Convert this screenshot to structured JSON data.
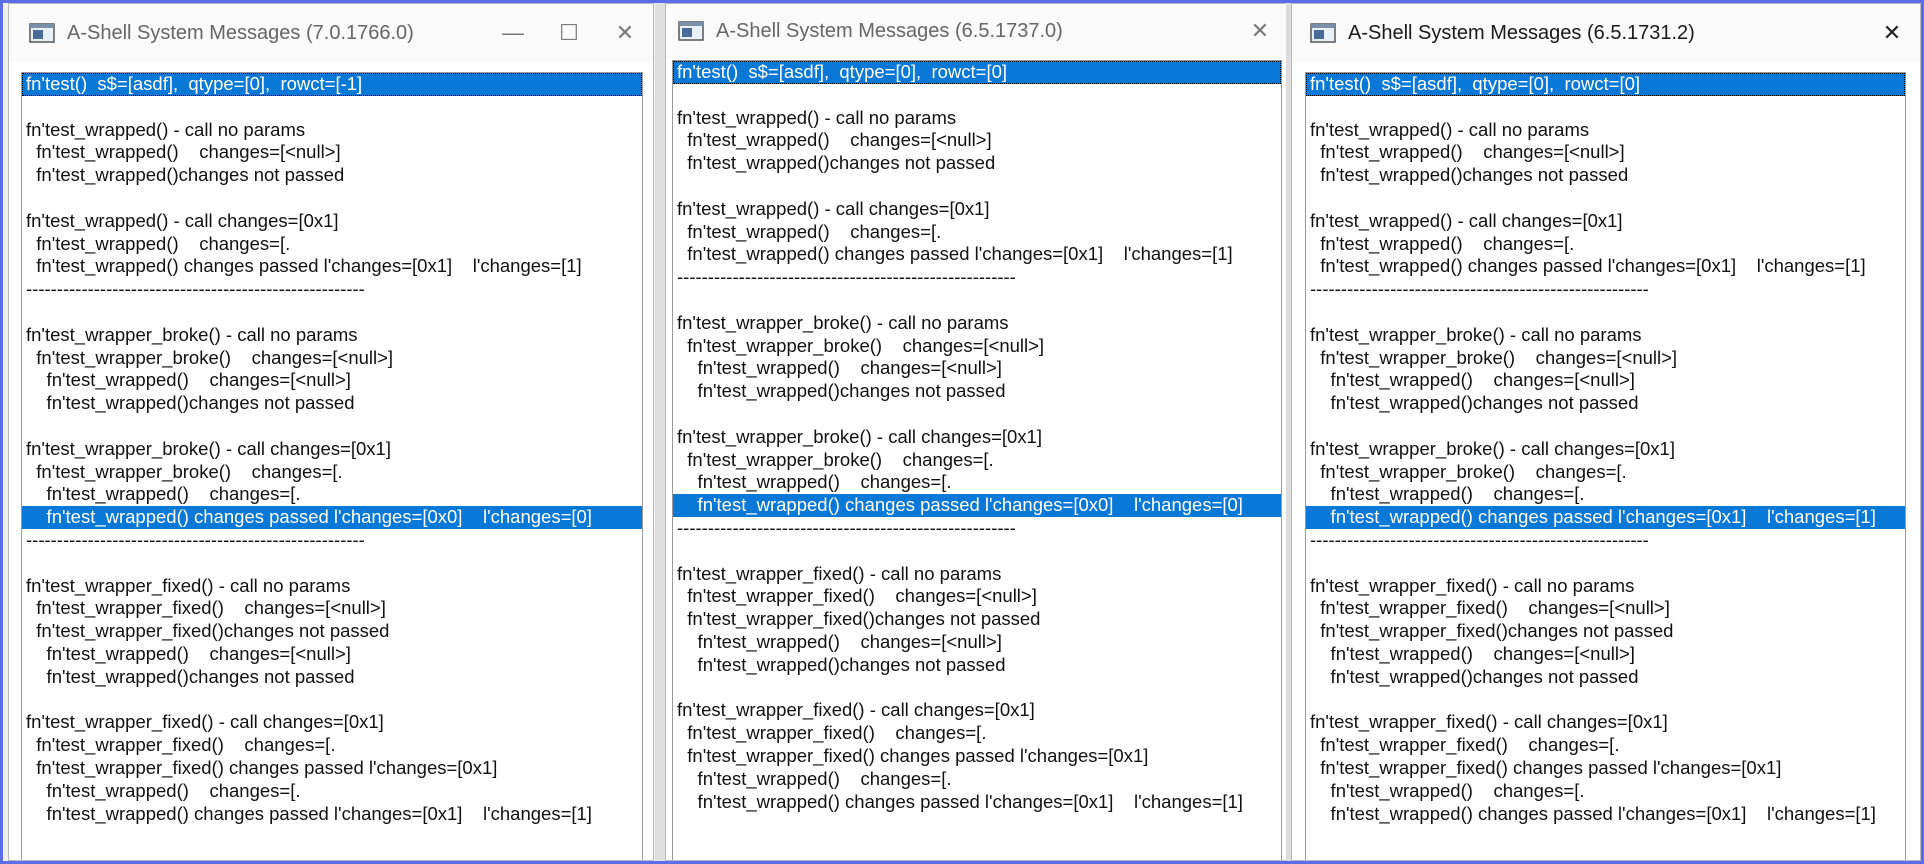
{
  "windows": [
    {
      "title": "A-Shell System Messages (7.0.1766.0)",
      "selected": [
        0,
        19
      ],
      "lines": [
        "fn'test()  s$=[asdf],  qtype=[0],  rowct=[-1]",
        "",
        "fn'test_wrapped() - call no params",
        "  fn'test_wrapped()    changes=[<null>]",
        "  fn'test_wrapped()changes not passed",
        "",
        "fn'test_wrapped() - call changes=[0x1]",
        "  fn'test_wrapped()    changes=[.",
        "  fn'test_wrapped() changes passed l'changes=[0x1]    l'changes=[1]",
        "-------------------------------------------------------",
        "",
        "fn'test_wrapper_broke() - call no params",
        "  fn'test_wrapper_broke()    changes=[<null>]",
        "    fn'test_wrapped()    changes=[<null>]",
        "    fn'test_wrapped()changes not passed",
        "",
        "fn'test_wrapper_broke() - call changes=[0x1]",
        "  fn'test_wrapper_broke()    changes=[.",
        "    fn'test_wrapped()    changes=[.",
        "    fn'test_wrapped() changes passed l'changes=[0x0]    l'changes=[0]",
        "-------------------------------------------------------",
        "",
        "fn'test_wrapper_fixed() - call no params",
        "  fn'test_wrapper_fixed()    changes=[<null>]",
        "  fn'test_wrapper_fixed()changes not passed",
        "    fn'test_wrapped()    changes=[<null>]",
        "    fn'test_wrapped()changes not passed",
        "",
        "fn'test_wrapper_fixed() - call changes=[0x1]",
        "  fn'test_wrapper_fixed()    changes=[.",
        "  fn'test_wrapper_fixed() changes passed l'changes=[0x1]",
        "    fn'test_wrapped()    changes=[.",
        "    fn'test_wrapped() changes passed l'changes=[0x1]    l'changes=[1]"
      ]
    },
    {
      "title": "A-Shell System Messages (6.5.1737.0)",
      "selected": [
        0,
        19
      ],
      "lines": [
        "fn'test()  s$=[asdf],  qtype=[0],  rowct=[0]",
        "",
        "fn'test_wrapped() - call no params",
        "  fn'test_wrapped()    changes=[<null>]",
        "  fn'test_wrapped()changes not passed",
        "",
        "fn'test_wrapped() - call changes=[0x1]",
        "  fn'test_wrapped()    changes=[.",
        "  fn'test_wrapped() changes passed l'changes=[0x1]    l'changes=[1]",
        "-------------------------------------------------------",
        "",
        "fn'test_wrapper_broke() - call no params",
        "  fn'test_wrapper_broke()    changes=[<null>]",
        "    fn'test_wrapped()    changes=[<null>]",
        "    fn'test_wrapped()changes not passed",
        "",
        "fn'test_wrapper_broke() - call changes=[0x1]",
        "  fn'test_wrapper_broke()    changes=[.",
        "    fn'test_wrapped()    changes=[.",
        "    fn'test_wrapped() changes passed l'changes=[0x0]    l'changes=[0]",
        "-------------------------------------------------------",
        "",
        "fn'test_wrapper_fixed() - call no params",
        "  fn'test_wrapper_fixed()    changes=[<null>]",
        "  fn'test_wrapper_fixed()changes not passed",
        "    fn'test_wrapped()    changes=[<null>]",
        "    fn'test_wrapped()changes not passed",
        "",
        "fn'test_wrapper_fixed() - call changes=[0x1]",
        "  fn'test_wrapper_fixed()    changes=[.",
        "  fn'test_wrapper_fixed() changes passed l'changes=[0x1]",
        "    fn'test_wrapped()    changes=[.",
        "    fn'test_wrapped() changes passed l'changes=[0x1]    l'changes=[1]"
      ]
    },
    {
      "title": "A-Shell System Messages (6.5.1731.2)",
      "selected": [
        0,
        19
      ],
      "lines": [
        "fn'test()  s$=[asdf],  qtype=[0],  rowct=[0]",
        "",
        "fn'test_wrapped() - call no params",
        "  fn'test_wrapped()    changes=[<null>]",
        "  fn'test_wrapped()changes not passed",
        "",
        "fn'test_wrapped() - call changes=[0x1]",
        "  fn'test_wrapped()    changes=[.",
        "  fn'test_wrapped() changes passed l'changes=[0x1]    l'changes=[1]",
        "-------------------------------------------------------",
        "",
        "fn'test_wrapper_broke() - call no params",
        "  fn'test_wrapper_broke()    changes=[<null>]",
        "    fn'test_wrapped()    changes=[<null>]",
        "    fn'test_wrapped()changes not passed",
        "",
        "fn'test_wrapper_broke() - call changes=[0x1]",
        "  fn'test_wrapper_broke()    changes=[.",
        "    fn'test_wrapped()    changes=[.",
        "    fn'test_wrapped() changes passed l'changes=[0x1]    l'changes=[1]",
        "-------------------------------------------------------",
        "",
        "fn'test_wrapper_fixed() - call no params",
        "  fn'test_wrapper_fixed()    changes=[<null>]",
        "  fn'test_wrapper_fixed()changes not passed",
        "    fn'test_wrapped()    changes=[<null>]",
        "    fn'test_wrapped()changes not passed",
        "",
        "fn'test_wrapper_fixed() - call changes=[0x1]",
        "  fn'test_wrapper_fixed()    changes=[.",
        "  fn'test_wrapper_fixed() changes passed l'changes=[0x1]",
        "    fn'test_wrapped()    changes=[.",
        "    fn'test_wrapped() changes passed l'changes=[0x1]    l'changes=[1]"
      ]
    }
  ],
  "controls": {
    "minimize": "—",
    "maximize": "☐",
    "close": "✕"
  },
  "colors": {
    "selection": "#0a78d7",
    "frame_border": "#5b6ee8"
  },
  "icons": {
    "app": "ashell-app-icon"
  }
}
